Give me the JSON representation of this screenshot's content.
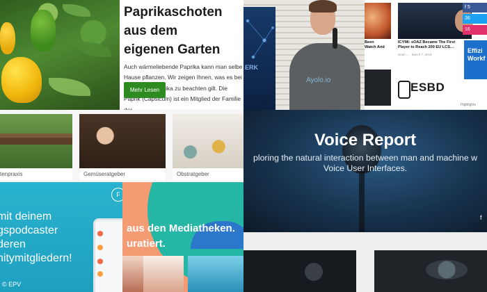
{
  "paprika": {
    "title": "Paprikaschoten aus dem\neigenen Garten",
    "body": "Auch wärmeliebende Paprika kann man selbe Hause pflanzen. Wir zeigen Ihnen, was es bei Anbau von Paprika zu beachten gilt. Die Paprik (Capsicum) ist ein Mitglied der Familie der…",
    "button_label": "Mehr Lesen"
  },
  "speaker": {
    "banner_text": "ERK",
    "shirt_text": "Ayolo.io"
  },
  "news": {
    "caption_left": "Been\nWatch And",
    "caption_main": "ICYMI: sOAZ Became The First\nPlayer to Reach 200 EU LCS…",
    "date_main": "Noah ... · March 7, 2018",
    "social": [
      "f  5",
      "  36",
      "  16"
    ],
    "promo": "Effizi\nWorkf",
    "logo": "ESBD",
    "tag": "Highlights"
  },
  "garden": {
    "categories": [
      "tenpraxis",
      "Gemüseratgeber",
      "Obstratgeber"
    ]
  },
  "voice": {
    "title": "Voice Report",
    "subtitle": "ploring the natural interaction between man and machine w\nVoice User Interfaces.",
    "social_icon": "f"
  },
  "podcast": {
    "headline": "mit deinem\ngspodcaster\nderen\nnitymitgliedern!",
    "search_icon": "F"
  },
  "media": {
    "headline": " aus den Mediatheken.\nuratiert."
  },
  "credit": "© EPV"
}
